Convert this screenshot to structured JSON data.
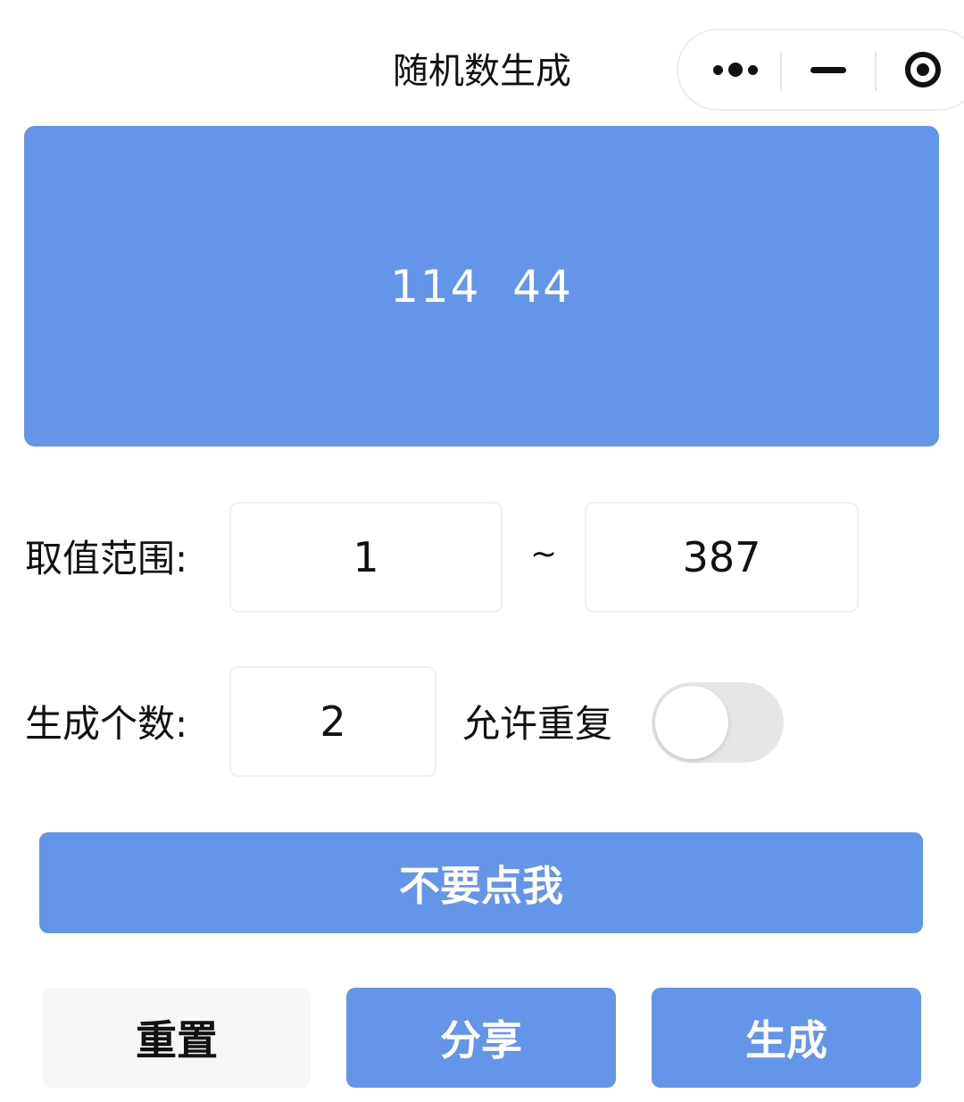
{
  "nav": {
    "title": "随机数生成"
  },
  "result": {
    "text": "114  44"
  },
  "range": {
    "label": "取值范围:",
    "min_value": "1",
    "separator": "~",
    "max_value": "387"
  },
  "count": {
    "label": "生成个数:",
    "value": "2",
    "allow_repeat_label": "允许重复",
    "allow_repeat_enabled": false
  },
  "buttons": {
    "main": "不要点我",
    "reset": "重置",
    "share": "分享",
    "generate": "生成"
  },
  "colors": {
    "accent": "#6595e8",
    "reset_bg": "#f7f7f7",
    "toggle_off": "#e6e6e6"
  },
  "icons": {
    "more": "more-icon",
    "minimize": "minimize-icon",
    "close": "target-close-icon"
  }
}
